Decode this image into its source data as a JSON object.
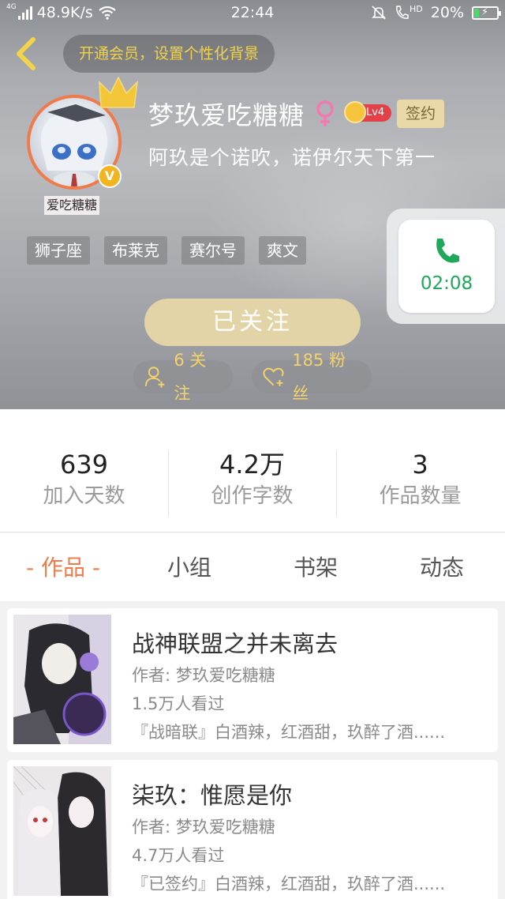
{
  "status_bar": {
    "network_tag": "4G",
    "speed": "48.9K/s",
    "time": "22:44",
    "hd_tag": "HD",
    "battery": "20%",
    "battery_level": 0.2
  },
  "header": {
    "vip_banner": "开通会员，设置个性化背景",
    "avatar_caption": "爱吃糖糖",
    "verified_badge": "V",
    "username": "梦玖爱吃糖糖",
    "level": "Lv4",
    "sign_tag": "签约",
    "bio": "阿玖是个诺吹，诺伊尔天下第一",
    "tags": [
      "狮子座",
      "布莱克",
      "赛尔号",
      "爽文"
    ],
    "follow_button": "已关注",
    "following_chip": "6 关注",
    "fans_chip": "185 粉丝"
  },
  "call_overlay": {
    "duration": "02:08"
  },
  "stats": [
    {
      "value": "639",
      "label": "加入天数"
    },
    {
      "value": "4.2万",
      "label": "创作字数"
    },
    {
      "value": "3",
      "label": "作品数量"
    }
  ],
  "tabs": [
    {
      "label": "- 作品 -",
      "active": true
    },
    {
      "label": "小组",
      "active": false
    },
    {
      "label": "书架",
      "active": false
    },
    {
      "label": "动态",
      "active": false
    }
  ],
  "books": [
    {
      "title": "战神联盟之并未离去",
      "author": "作者: 梦玖爱吃糖糖",
      "views": "1.5万人看过",
      "description": "『战暗联』白酒辣，红酒甜，玖醉了酒......"
    },
    {
      "title": "柒玖：惟愿是你",
      "author": "作者: 梦玖爱吃糖糖",
      "views": "4.7万人看过",
      "description": "『已签约』白酒辣，红酒甜，玖醉了酒......"
    }
  ],
  "colors": {
    "accent": "#f07b4a",
    "vip_gold": "#f1d34a",
    "call_green": "#1fa75a",
    "follow_button": "#e3d4a8",
    "level_red": "#e2414a"
  },
  "icons": {
    "back": "chevron-left-icon",
    "gender": "female-icon",
    "phone": "phone-icon",
    "follow": "add-user-icon",
    "fans": "heart-plus-icon",
    "crown": "crown-icon"
  }
}
